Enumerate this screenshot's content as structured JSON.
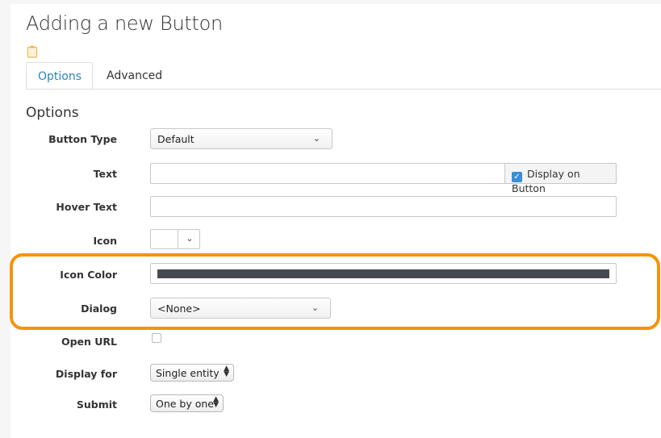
{
  "page": {
    "title": "Adding a new Button"
  },
  "tabs": [
    {
      "label": "Options",
      "active": true
    },
    {
      "label": "Advanced",
      "active": false
    }
  ],
  "section": {
    "title": "Options"
  },
  "form": {
    "button_type": {
      "label": "Button Type",
      "value": "Default"
    },
    "text": {
      "label": "Text",
      "value": "",
      "addon_label": "Display on Button",
      "addon_checked": true
    },
    "hover_text": {
      "label": "Hover Text",
      "value": ""
    },
    "icon": {
      "label": "Icon"
    },
    "icon_color": {
      "label": "Icon Color",
      "color": "#454a52"
    },
    "dialog": {
      "label": "Dialog",
      "value": "<None>"
    },
    "open_url": {
      "label": "Open URL",
      "checked": false
    },
    "display_for": {
      "label": "Display for",
      "value": "Single entity"
    },
    "submit": {
      "label": "Submit",
      "value": "One by one"
    }
  },
  "icons": {
    "page_icon": "clipboard-icon",
    "dropdown": "chevron-down-icon",
    "stepper": "updown-arrows-icon"
  },
  "colors": {
    "accent": "#2a86ba",
    "highlight": "#f5930b",
    "checkbox": "#3b8ed8"
  }
}
